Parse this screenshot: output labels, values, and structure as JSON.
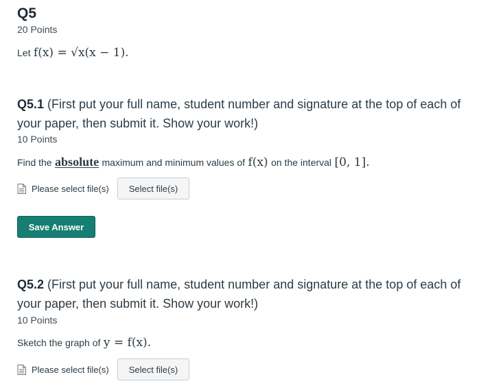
{
  "question": {
    "title": "Q5",
    "points": "20 Points",
    "intro_prefix": "Let",
    "intro_math": "f(x) = √x(x − 1)."
  },
  "q51": {
    "number": "Q5.1",
    "title_text": "(First put your full name, student number and signature at the top of each of your paper, then submit it. Show your work!)",
    "points": "10 Points",
    "prompt_prefix": "Find the",
    "prompt_emphasis": "absolute",
    "prompt_middle": "maximum and minimum values of",
    "prompt_math": "f(x)",
    "prompt_suffix": "on the interval",
    "prompt_interval": "[0, 1].",
    "file_label": "Please select file(s)",
    "select_button": "Select file(s)",
    "save_button": "Save Answer"
  },
  "q52": {
    "number": "Q5.2",
    "title_text": "(First put your full name, student number and signature at the top of each of your paper, then submit it. Show your work!)",
    "points": "10 Points",
    "prompt_prefix": "Sketch the graph of",
    "prompt_math": "y = f(x).",
    "file_label": "Please select file(s)",
    "select_button": "Select file(s)"
  },
  "icons": {
    "file": "document-icon"
  },
  "colors": {
    "save_button_bg": "#167e72",
    "text": "#2d3b45"
  }
}
